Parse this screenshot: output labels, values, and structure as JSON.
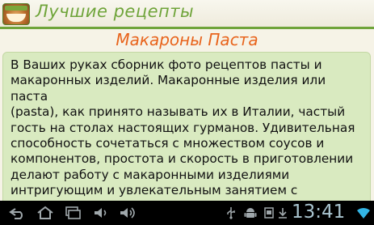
{
  "app": {
    "title": "Лучшие рецепты"
  },
  "recipe": {
    "title": "Макароны Паста",
    "description": "В Ваших руках сборник фото рецептов пасты и\nмакаронных изделий. Макаронные изделия или паста\n(pasta), как принято называть их в Италии, частый\nгость на столах настоящих гурманов. Удивительная\nспособность сочетаться с множеством соусов и\nкомпонентов, простота и скорость в приготовлении\nделают работу с макаронными изделиями\nинтригующим и увлекательным занятием с\nнеизменно превосходно вкусным результатом!"
  },
  "system_bar": {
    "clock": "13:41",
    "buttons": [
      "back-icon",
      "home-icon",
      "recent-apps-icon",
      "volume-down-icon",
      "volume-up-icon"
    ],
    "status_icons": [
      "usb-icon",
      "android-debug-icon",
      "screenshot-icon",
      "download-icon",
      "wifi-icon"
    ]
  },
  "colors": {
    "accent_green": "#6fa43a",
    "title_orange": "#e8641c",
    "card_green": "#d9eac0",
    "background": "#f6f3e7",
    "clock_blue": "#a9c4cf"
  }
}
